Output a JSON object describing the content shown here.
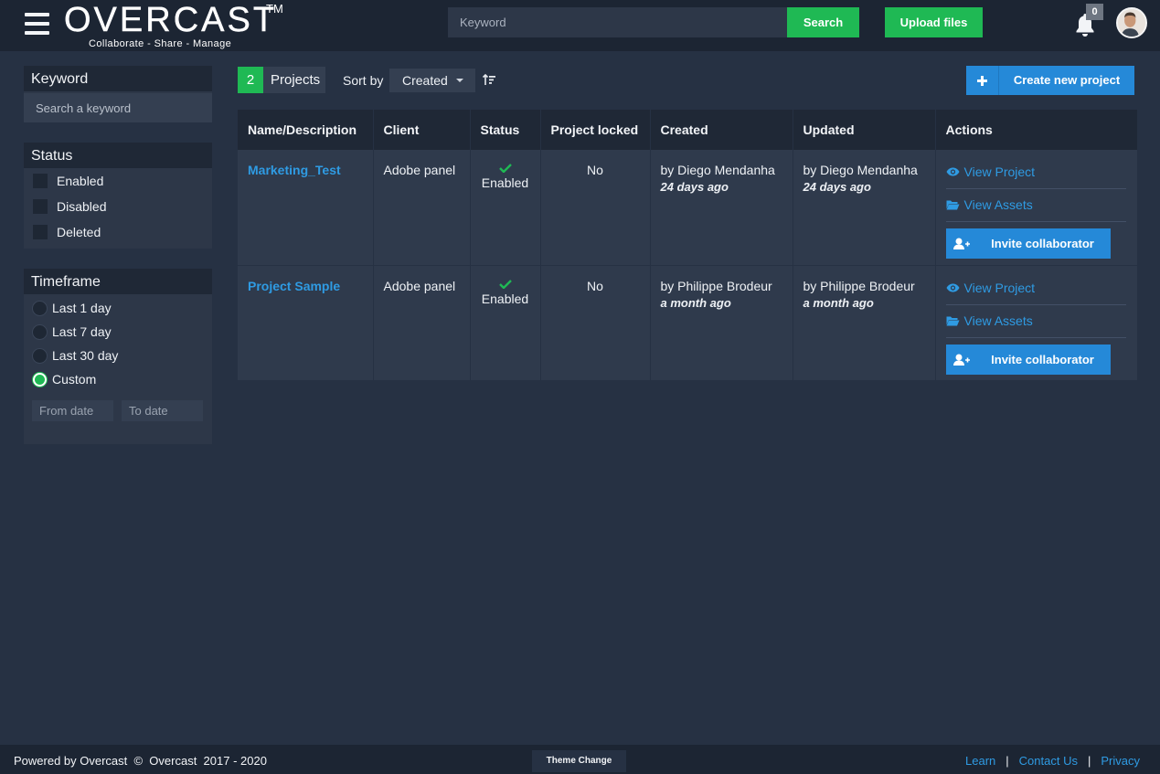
{
  "header": {
    "logo_text": "OVERCAST",
    "logo_tm": "TM",
    "tagline": "Collaborate - Share - Manage",
    "search_placeholder": "Keyword",
    "search_label": "Search",
    "upload_label": "Upload files",
    "notification_count": "0"
  },
  "sidebar": {
    "keyword": {
      "title": "Keyword",
      "placeholder": "Search a keyword"
    },
    "status": {
      "title": "Status",
      "options": [
        "Enabled",
        "Disabled",
        "Deleted"
      ]
    },
    "timeframe": {
      "title": "Timeframe",
      "options": [
        "Last 1 day",
        "Last 7 day",
        "Last 30 day",
        "Custom"
      ],
      "selected": "Custom",
      "from_placeholder": "From date",
      "to_placeholder": "To date"
    }
  },
  "toolbar": {
    "count": "2",
    "count_label": "Projects",
    "sort_label": "Sort by",
    "sort_value": "Created",
    "create_label": "Create new project"
  },
  "table": {
    "headers": [
      "Name/Description",
      "Client",
      "Status",
      "Project locked",
      "Created",
      "Updated",
      "Actions"
    ],
    "rows": [
      {
        "name": "Marketing_Test",
        "client": "Adobe panel",
        "status": "Enabled",
        "locked": "No",
        "created_by": "by Diego Mendanha",
        "created_ago": "24 days ago",
        "updated_by": "by Diego Mendanha",
        "updated_ago": "24 days ago"
      },
      {
        "name": "Project Sample",
        "client": "Adobe panel",
        "status": "Enabled",
        "locked": "No",
        "created_by": "by Philippe Brodeur",
        "created_ago": "a month ago",
        "updated_by": "by Philippe Brodeur",
        "updated_ago": "a month ago"
      }
    ],
    "actions": {
      "view_project": "View Project",
      "view_assets": "View Assets",
      "invite": "Invite collaborator"
    }
  },
  "footer": {
    "powered": "Powered by Overcast  ©  Overcast  2017 - 2020",
    "theme_label": "Theme Change",
    "links": [
      "Learn",
      "Contact Us",
      "Privacy"
    ]
  },
  "colors": {
    "accent_green": "#1fb954",
    "accent_blue": "#2589d8",
    "link_blue": "#2f9be3",
    "background": "#263143"
  }
}
